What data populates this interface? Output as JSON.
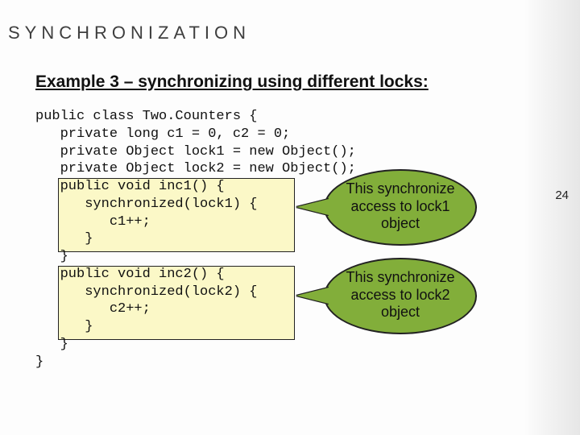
{
  "header": "SYNCHRONIZATION",
  "subhead": "Example 3 – synchronizing using different locks:",
  "code": {
    "l1": "public class Two.Counters {",
    "l2": "   private long c1 = 0, c2 = 0;",
    "l3": "   private Object lock1 = new Object();",
    "l4": "   private Object lock2 = new Object();",
    "l5": "   public void inc1() {",
    "l6": "      synchronized(lock1) {",
    "l7": "         c1++;",
    "l8": "      }",
    "l9": "   }",
    "l10": "   public void inc2() {",
    "l11": "      synchronized(lock2) {",
    "l12": "         c2++;",
    "l13": "      }",
    "l14": "   }",
    "l15": "}"
  },
  "callout1": {
    "line1": "This synchronize",
    "line2": "access to lock1",
    "line3": "object"
  },
  "callout2": {
    "line1": "This synchronize",
    "line2": "access to lock2",
    "line3": "object"
  },
  "page_number": "24"
}
